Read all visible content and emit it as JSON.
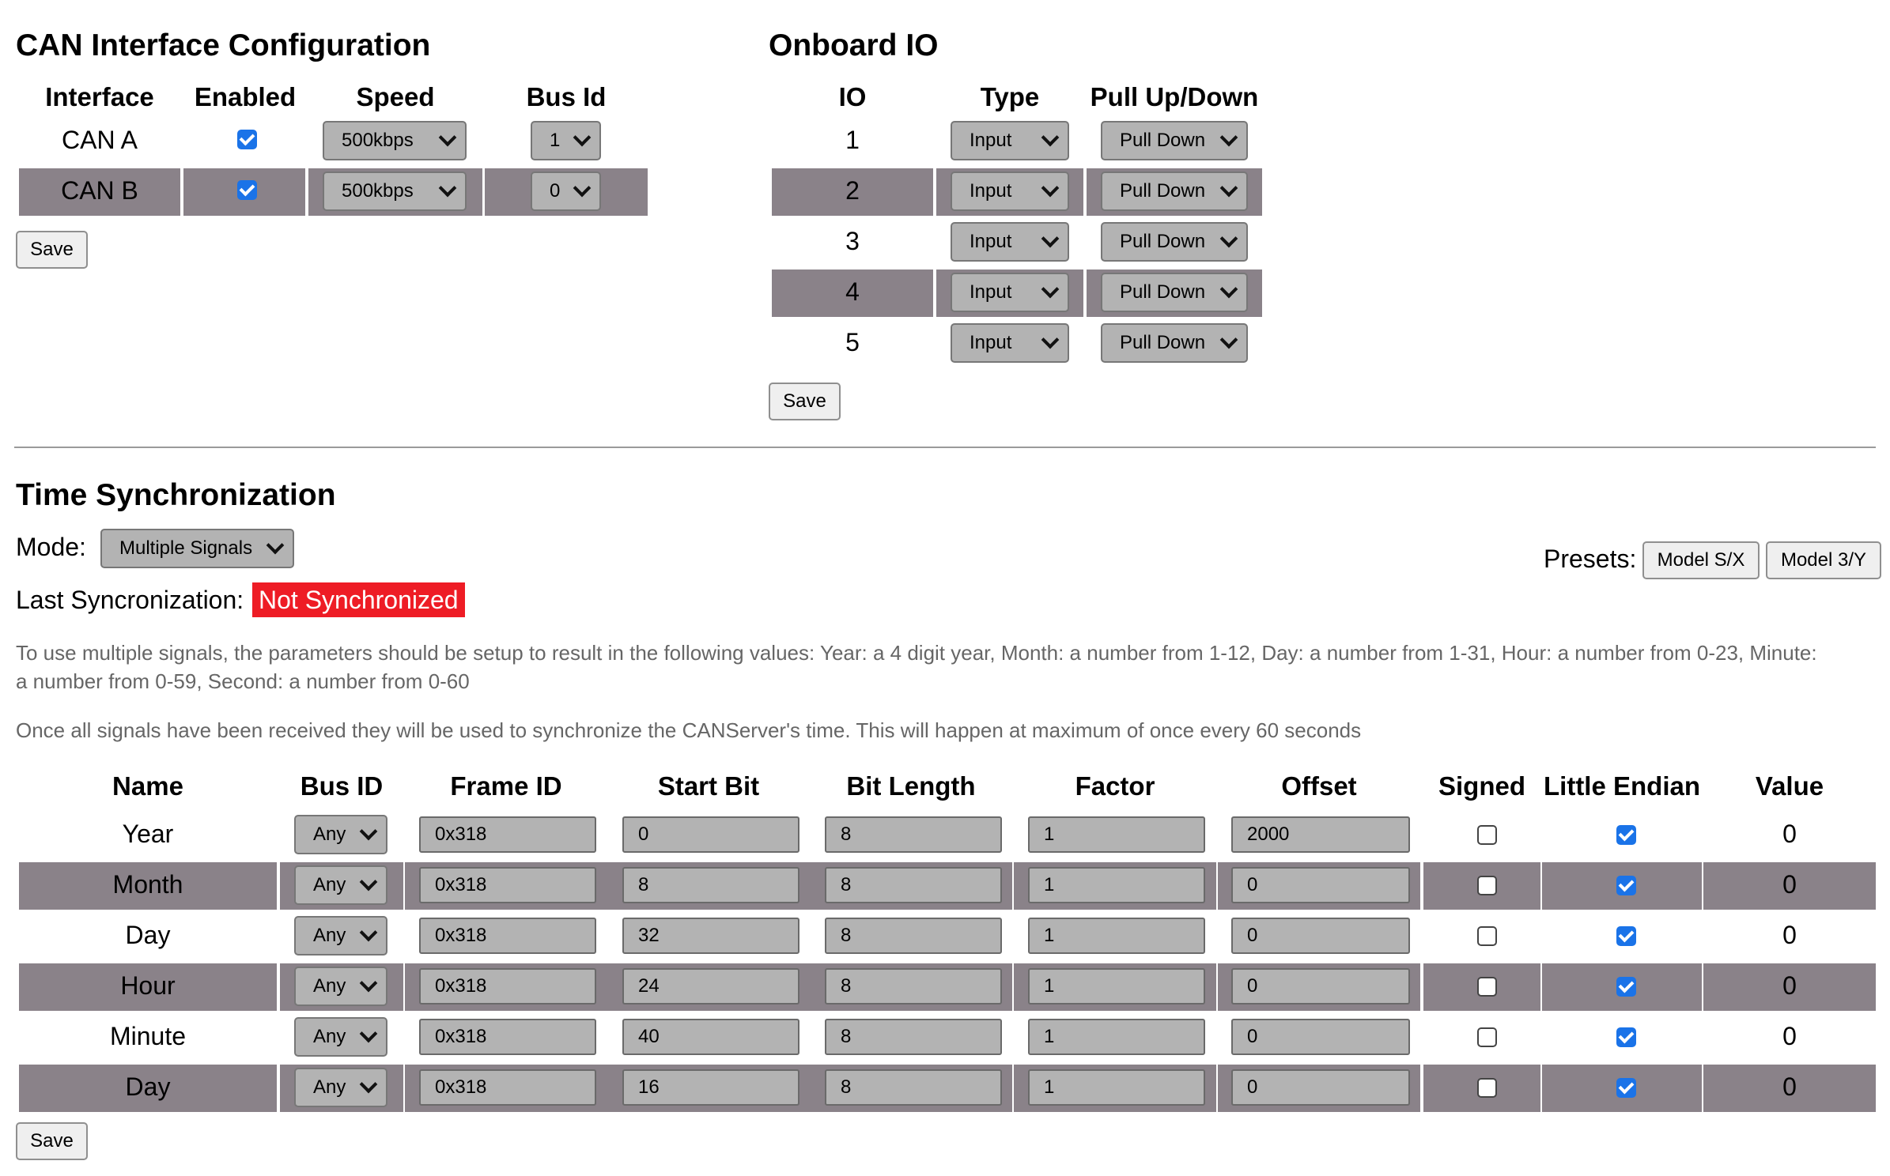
{
  "can": {
    "title": "CAN Interface Configuration",
    "headers": [
      "Interface",
      "Enabled",
      "Speed",
      "Bus Id"
    ],
    "rows": [
      {
        "interface": "CAN A",
        "enabled": true,
        "speed": "500kbps",
        "bus_id": "1"
      },
      {
        "interface": "CAN B",
        "enabled": true,
        "speed": "500kbps",
        "bus_id": "0"
      }
    ],
    "save_label": "Save"
  },
  "io": {
    "title": "Onboard IO",
    "headers": [
      "IO",
      "Type",
      "Pull Up/Down"
    ],
    "rows": [
      {
        "io": "1",
        "type": "Input",
        "pull": "Pull Down"
      },
      {
        "io": "2",
        "type": "Input",
        "pull": "Pull Down"
      },
      {
        "io": "3",
        "type": "Input",
        "pull": "Pull Down"
      },
      {
        "io": "4",
        "type": "Input",
        "pull": "Pull Down"
      },
      {
        "io": "5",
        "type": "Input",
        "pull": "Pull Down"
      }
    ],
    "save_label": "Save"
  },
  "time": {
    "title": "Time Synchronization",
    "mode_label": "Mode:",
    "mode_value": "Multiple Signals",
    "presets_label": "Presets:",
    "presets": [
      "Model S/X",
      "Model 3/Y"
    ],
    "last_sync_label": "Last Syncronization:",
    "last_sync_value": "Not Synchronized",
    "description1a": "To use multiple signals, the parameters should be setup to result in the following values: Year: a 4 digit year, Month: a number from 1-12, Day: a number from 1-31, Hour: a number from 0-23, Minute:",
    "description1b": "a number from 0-59, Second: a number from 0-60",
    "description2": "Once all signals have been received they will be used to synchronize the CANServer's time. This will happen at maximum of once every 60 seconds",
    "headers": [
      "Name",
      "Bus ID",
      "Frame ID",
      "Start Bit",
      "Bit Length",
      "Factor",
      "Offset",
      "Signed",
      "Little Endian",
      "Value"
    ],
    "rows": [
      {
        "name": "Year",
        "bus": "Any",
        "frame": "0x318",
        "start": "0",
        "length": "8",
        "factor": "1",
        "offset": "2000",
        "signed": false,
        "little": true,
        "value": "0"
      },
      {
        "name": "Month",
        "bus": "Any",
        "frame": "0x318",
        "start": "8",
        "length": "8",
        "factor": "1",
        "offset": "0",
        "signed": false,
        "little": true,
        "value": "0"
      },
      {
        "name": "Day",
        "bus": "Any",
        "frame": "0x318",
        "start": "32",
        "length": "8",
        "factor": "1",
        "offset": "0",
        "signed": false,
        "little": true,
        "value": "0"
      },
      {
        "name": "Hour",
        "bus": "Any",
        "frame": "0x318",
        "start": "24",
        "length": "8",
        "factor": "1",
        "offset": "0",
        "signed": false,
        "little": true,
        "value": "0"
      },
      {
        "name": "Minute",
        "bus": "Any",
        "frame": "0x318",
        "start": "40",
        "length": "8",
        "factor": "1",
        "offset": "0",
        "signed": false,
        "little": true,
        "value": "0"
      },
      {
        "name": "Day",
        "bus": "Any",
        "frame": "0x318",
        "start": "16",
        "length": "8",
        "factor": "1",
        "offset": "0",
        "signed": false,
        "little": true,
        "value": "0"
      }
    ],
    "save_label": "Save"
  },
  "colors": {
    "band": "#8a8289",
    "status_bg": "#ee1c25",
    "checkbox": "#1a73e8"
  }
}
